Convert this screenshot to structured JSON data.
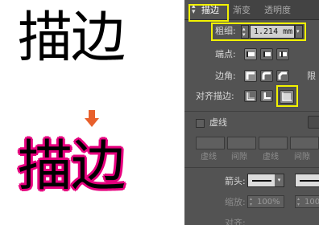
{
  "illustration": {
    "top_text": "描边",
    "bottom_text": "描边",
    "stroke_color": "#e6007e",
    "arrow_color": "#e8602c"
  },
  "panel": {
    "tabs": [
      {
        "label": "描边",
        "icon": "collapse-toggle-icon"
      },
      {
        "label": "渐变"
      },
      {
        "label": "透明度"
      }
    ],
    "weight_label": "粗细:",
    "weight_value": "1.214 mm",
    "cap_label": "端点:",
    "corner_label": "边角:",
    "limit_label": "限",
    "align_label": "对齐描边:",
    "dashed_label": "虚线",
    "dash_labels": [
      "虚线",
      "间隙",
      "虚线",
      "间隙"
    ],
    "arrow_label": "箭头:",
    "scale_label": "缩放:",
    "scale_value_1": "100%",
    "scale_value_2": "100%",
    "align_partial_label": "对齐:",
    "highlight_color": "#f2f200"
  }
}
